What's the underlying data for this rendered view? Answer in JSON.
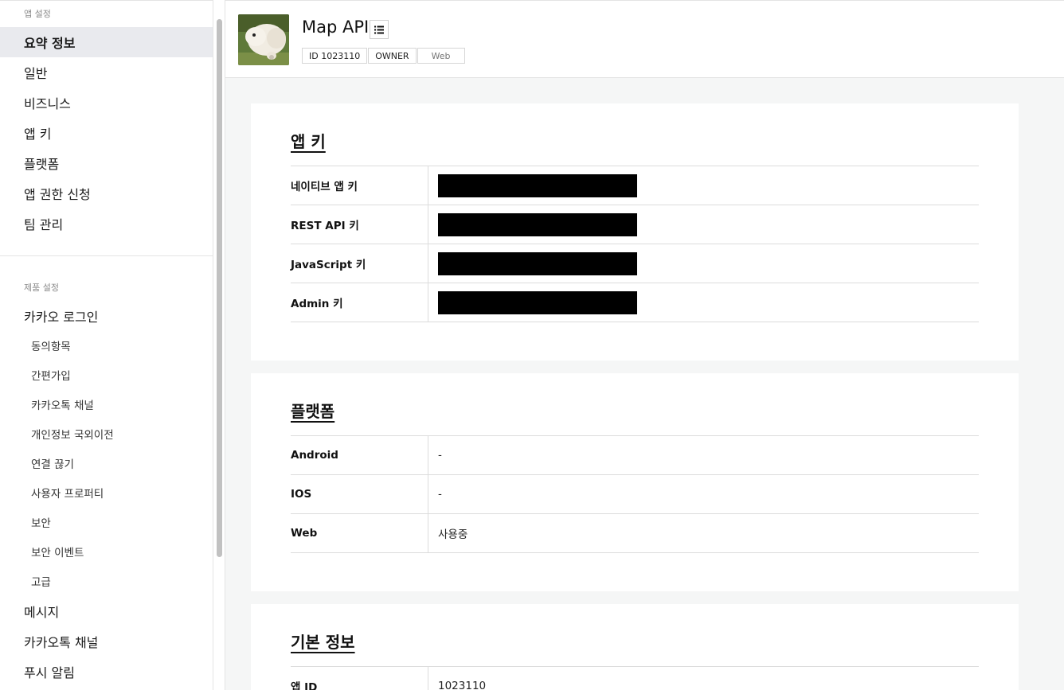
{
  "sidebar": {
    "app_settings_title": "앱 설정",
    "app_items": [
      {
        "label": "요약 정보",
        "active": true
      },
      {
        "label": "일반"
      },
      {
        "label": "비즈니스"
      },
      {
        "label": "앱 키"
      },
      {
        "label": "플랫폼"
      },
      {
        "label": "앱 권한 신청"
      },
      {
        "label": "팀 관리"
      }
    ],
    "product_settings_title": "제품 설정",
    "kakao_login": "카카오 로그인",
    "kakao_login_subitems": [
      "동의항목",
      "간편가입",
      "카카오톡 채널",
      "개인정보 국외이전",
      "연결 끊기",
      "사용자 프로퍼티",
      "보안",
      "보안 이벤트",
      "고급"
    ],
    "more_items": [
      "메시지",
      "카카오톡 채널",
      "푸시 알림"
    ]
  },
  "header": {
    "app_name": "Map API",
    "menu_icon": "list-icon",
    "badges": {
      "id": "ID 1023110",
      "role": "OWNER",
      "platform": "Web"
    }
  },
  "app_keys": {
    "title": "앱 키",
    "rows": [
      {
        "label": "네이티브 앱 키"
      },
      {
        "label": "REST API 키"
      },
      {
        "label": "JavaScript 키"
      },
      {
        "label": "Admin 키"
      }
    ]
  },
  "platform": {
    "title": "플랫폼",
    "rows": [
      {
        "label": "Android",
        "value": "-"
      },
      {
        "label": "IOS",
        "value": "-"
      },
      {
        "label": "Web",
        "value": "사용중"
      }
    ]
  },
  "basic_info": {
    "title": "기본 정보",
    "rows": [
      {
        "label": "앱 ID",
        "value": "1023110"
      }
    ]
  }
}
